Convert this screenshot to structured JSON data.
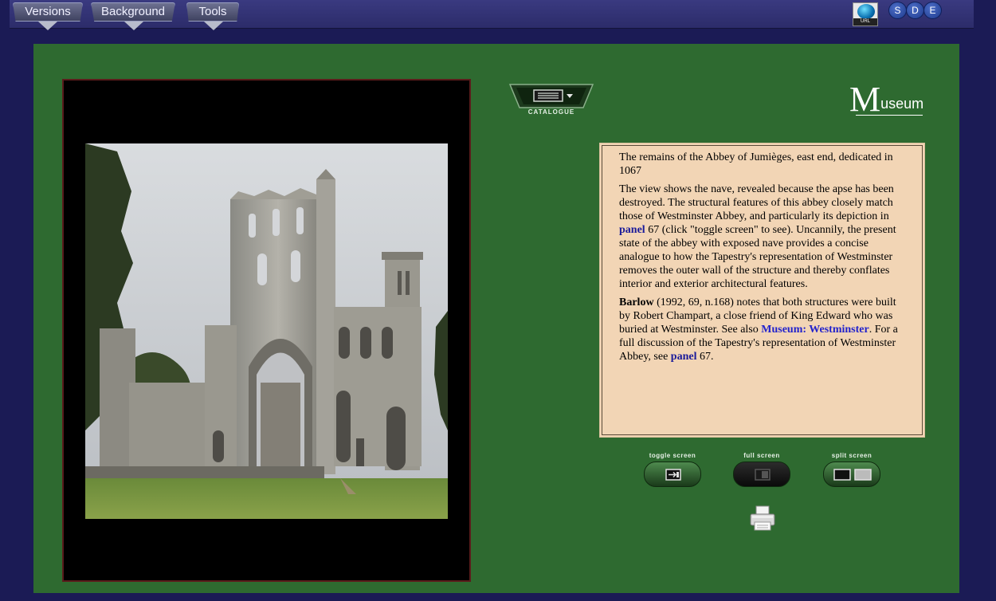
{
  "menu": {
    "versions": "Versions",
    "background": "Background",
    "tools": "Tools"
  },
  "topright": {
    "url_label": "URL",
    "lang_s": "S",
    "lang_d": "D",
    "lang_e": "E"
  },
  "catalogue": {
    "label": "CATALOGUE"
  },
  "museum": {
    "big_letter": "M",
    "rest": "useum"
  },
  "text": {
    "p1": "The remains of the Abbey of Jumièges, east end, dedicated in 1067",
    "p2_a": "The view shows the nave, revealed because the apse has been destroyed. The structural features of this abbey closely match those of Westminster Abbey, and particularly its depiction in ",
    "p2_link": "panel",
    "p2_b": " 67 (click \"toggle screen\" to see). Uncannily, the present state of the abbey with exposed nave provides a concise analogue to how the Tapestry's representation of Westminster removes the outer wall of the structure and thereby conflates interior and exterior architectural features.",
    "p3_bold": "Barlow",
    "p3_a": " (1992, 69, n.168) notes that both structures were built by Robert Champart, a close friend of King Edward who was buried at Westminster. See also ",
    "p3_link1": "Museum: Westminster",
    "p3_b": ". For a full discussion of the Tapestry's representation of Westminster Abbey, see ",
    "p3_link2": "panel",
    "p3_c": " 67."
  },
  "controls": {
    "toggle": "toggle screen",
    "full": "full screen",
    "split": "split screen"
  },
  "colors": {
    "background": "#1b1b55",
    "panel_green": "#2e6a30",
    "textbox": "#f2d5b5",
    "link": "#1a1a9a"
  }
}
